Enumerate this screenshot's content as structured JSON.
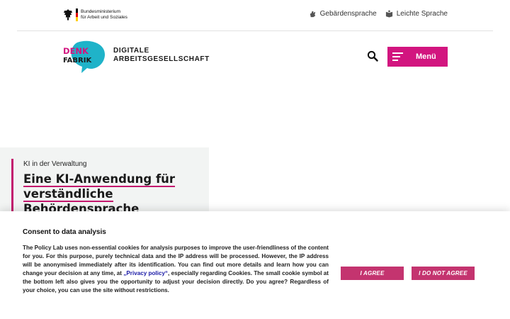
{
  "ministry": {
    "line1": "Bundesministerium",
    "line2": "für Arbeit und Soziales"
  },
  "utility_links": [
    {
      "label": "Gebärdensprache",
      "icon": "sign-language-icon"
    },
    {
      "label": "Leichte Sprache",
      "icon": "easy-language-icon"
    }
  ],
  "logo": {
    "word1": "DENK",
    "word2": "FABRIK",
    "line1": "DIGITALE",
    "line2": "ARBEITSGESELLSCHAFT"
  },
  "header": {
    "menu_label": "Menü",
    "search_icon": "search-icon",
    "menu_icon": "hamburger-icon"
  },
  "teaser": {
    "kicker": "KI in der Verwaltung",
    "title": "Eine KI-Anwendung für verständliche Behördensprache"
  },
  "consent": {
    "title": "Consent to data analysis",
    "text_before_link": "The Policy Lab uses non-essential cookies for analysis purposes to improve the user-friendliness of the content for you. For this purpose, purely technical data and the IP address will be processed. However, the IP address will be anonymised immediately after its identification. You can find out more details and learn how you can change your decision at any time, at ",
    "link_text": "„Privacy policy“",
    "text_after_link": ", especially regarding Cookies. The small cookie symbol at the bottom left also gives you the opportunity to adjust your decision directly. Do you agree? Regardless of your choice, you can use the site without restrictions.",
    "agree_label": "I AGREE",
    "disagree_label": "I DO NOT AGREE"
  },
  "colors": {
    "brand_magenta": "#d2157f",
    "button_pink": "#c4346f",
    "logo_teal": "#1fb3c9",
    "teaser_bg": "#f2f4f3"
  }
}
